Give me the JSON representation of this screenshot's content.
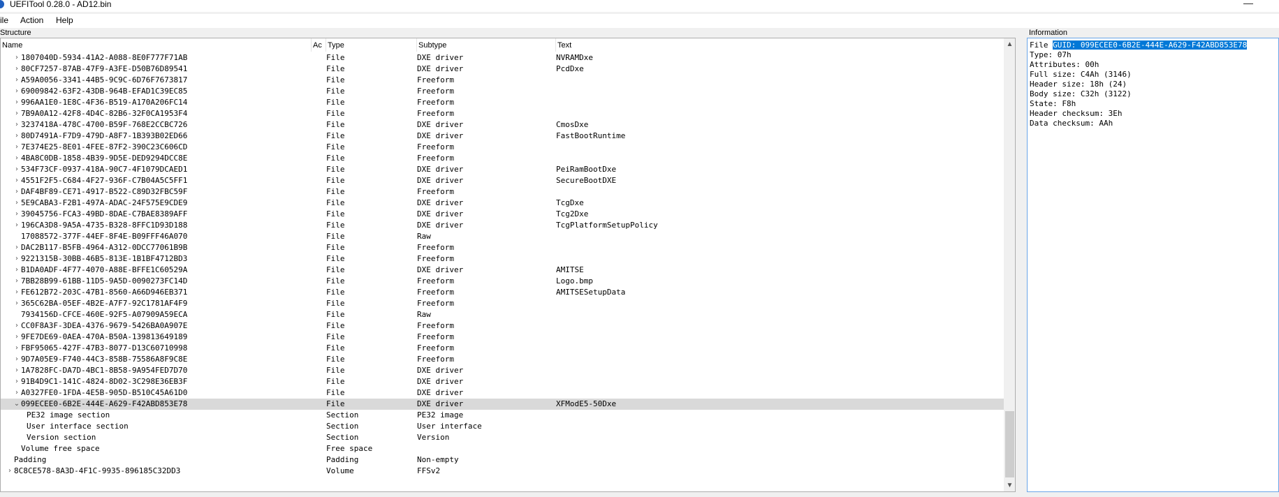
{
  "window": {
    "title": "UEFITool 0.28.0 - AD12.bin",
    "minimize_glyph": "—"
  },
  "menu": {
    "items": [
      "ile",
      "Action",
      "Help"
    ]
  },
  "panels": {
    "structure": "Structure",
    "information": "Information"
  },
  "columns": {
    "name": "Name",
    "action": "Ac",
    "type": "Type",
    "subtype": "Subtype",
    "text": "Text"
  },
  "tree_rows": [
    {
      "name": "1807040D-5934-41A2-A088-8E0F777F71AB",
      "type": "File",
      "subtype": "DXE driver",
      "text": "NVRAMDxe",
      "indent": 1,
      "expander": "collapsed"
    },
    {
      "name": "80CF7257-87AB-47F9-A3FE-D50B76D89541",
      "type": "File",
      "subtype": "DXE driver",
      "text": "PcdDxe",
      "indent": 1,
      "expander": "collapsed"
    },
    {
      "name": "A59A0056-3341-44B5-9C9C-6D76F7673817",
      "type": "File",
      "subtype": "Freeform",
      "text": "",
      "indent": 1,
      "expander": "collapsed"
    },
    {
      "name": "69009842-63F2-43DB-964B-EFAD1C39EC85",
      "type": "File",
      "subtype": "Freeform",
      "text": "",
      "indent": 1,
      "expander": "collapsed"
    },
    {
      "name": "996AA1E0-1E8C-4F36-B519-A170A206FC14",
      "type": "File",
      "subtype": "Freeform",
      "text": "",
      "indent": 1,
      "expander": "collapsed"
    },
    {
      "name": "7B9A0A12-42F8-4D4C-82B6-32F0CA1953F4",
      "type": "File",
      "subtype": "Freeform",
      "text": "",
      "indent": 1,
      "expander": "collapsed"
    },
    {
      "name": "3237418A-478C-4700-B59F-768E2CCBC726",
      "type": "File",
      "subtype": "DXE driver",
      "text": "CmosDxe",
      "indent": 1,
      "expander": "collapsed"
    },
    {
      "name": "80D7491A-F7D9-479D-A8F7-1B393B02ED66",
      "type": "File",
      "subtype": "DXE driver",
      "text": "FastBootRuntime",
      "indent": 1,
      "expander": "collapsed"
    },
    {
      "name": "7E374E25-8E01-4FEE-87F2-390C23C606CD",
      "type": "File",
      "subtype": "Freeform",
      "text": "",
      "indent": 1,
      "expander": "collapsed"
    },
    {
      "name": "4BA8C0DB-1858-4B39-9D5E-DED9294DCC8E",
      "type": "File",
      "subtype": "Freeform",
      "text": "",
      "indent": 1,
      "expander": "collapsed"
    },
    {
      "name": "534F73CF-0937-418A-90C7-4F1079DCAED1",
      "type": "File",
      "subtype": "DXE driver",
      "text": "PeiRamBootDxe",
      "indent": 1,
      "expander": "collapsed"
    },
    {
      "name": "4551F2F5-C684-4F27-936F-C7B04A5C5FF1",
      "type": "File",
      "subtype": "DXE driver",
      "text": "SecureBootDXE",
      "indent": 1,
      "expander": "collapsed"
    },
    {
      "name": "DAF4BF89-CE71-4917-B522-C89D32FBC59F",
      "type": "File",
      "subtype": "Freeform",
      "text": "",
      "indent": 1,
      "expander": "collapsed"
    },
    {
      "name": "5E9CABA3-F2B1-497A-ADAC-24F575E9CDE9",
      "type": "File",
      "subtype": "DXE driver",
      "text": "TcgDxe",
      "indent": 1,
      "expander": "collapsed"
    },
    {
      "name": "39045756-FCA3-49BD-8DAE-C7BAE8389AFF",
      "type": "File",
      "subtype": "DXE driver",
      "text": "Tcg2Dxe",
      "indent": 1,
      "expander": "collapsed"
    },
    {
      "name": "196CA3D8-9A5A-4735-B328-8FFC1D93D188",
      "type": "File",
      "subtype": "DXE driver",
      "text": "TcgPlatformSetupPolicy",
      "indent": 1,
      "expander": "collapsed"
    },
    {
      "name": "17088572-377F-44EF-8F4E-B09FFF46A070",
      "type": "File",
      "subtype": "Raw",
      "text": "",
      "indent": 1,
      "expander": "none"
    },
    {
      "name": "DAC2B117-B5FB-4964-A312-0DCC77061B9B",
      "type": "File",
      "subtype": "Freeform",
      "text": "",
      "indent": 1,
      "expander": "collapsed"
    },
    {
      "name": "9221315B-30BB-46B5-813E-1B1BF4712BD3",
      "type": "File",
      "subtype": "Freeform",
      "text": "",
      "indent": 1,
      "expander": "collapsed"
    },
    {
      "name": "B1DA0ADF-4F77-4070-A88E-BFFE1C60529A",
      "type": "File",
      "subtype": "DXE driver",
      "text": "AMITSE",
      "indent": 1,
      "expander": "collapsed"
    },
    {
      "name": "7BB28B99-61BB-11D5-9A5D-0090273FC14D",
      "type": "File",
      "subtype": "Freeform",
      "text": "Logo.bmp",
      "indent": 1,
      "expander": "collapsed"
    },
    {
      "name": "FE612B72-203C-47B1-8560-A66D946EB371",
      "type": "File",
      "subtype": "Freeform",
      "text": "AMITSESetupData",
      "indent": 1,
      "expander": "collapsed"
    },
    {
      "name": "365C62BA-05EF-4B2E-A7F7-92C1781AF4F9",
      "type": "File",
      "subtype": "Freeform",
      "text": "",
      "indent": 1,
      "expander": "collapsed"
    },
    {
      "name": "7934156D-CFCE-460E-92F5-A07909A59ECA",
      "type": "File",
      "subtype": "Raw",
      "text": "",
      "indent": 1,
      "expander": "none"
    },
    {
      "name": "CC0F8A3F-3DEA-4376-9679-5426BA0A907E",
      "type": "File",
      "subtype": "Freeform",
      "text": "",
      "indent": 1,
      "expander": "collapsed"
    },
    {
      "name": "9FE7DE69-0AEA-470A-B50A-139813649189",
      "type": "File",
      "subtype": "Freeform",
      "text": "",
      "indent": 1,
      "expander": "collapsed"
    },
    {
      "name": "FBF95065-427F-47B3-8077-D13C60710998",
      "type": "File",
      "subtype": "Freeform",
      "text": "",
      "indent": 1,
      "expander": "collapsed"
    },
    {
      "name": "9D7A05E9-F740-44C3-858B-75586A8F9C8E",
      "type": "File",
      "subtype": "Freeform",
      "text": "",
      "indent": 1,
      "expander": "collapsed"
    },
    {
      "name": "1A7828FC-DA7D-4BC1-8B58-9A954FED7D70",
      "type": "File",
      "subtype": "DXE driver",
      "text": "",
      "indent": 1,
      "expander": "collapsed"
    },
    {
      "name": "91B4D9C1-141C-4824-8D02-3C298E36EB3F",
      "type": "File",
      "subtype": "DXE driver",
      "text": "",
      "indent": 1,
      "expander": "collapsed"
    },
    {
      "name": "A0327FE0-1FDA-4E5B-905D-B510C45A61D0",
      "type": "File",
      "subtype": "DXE driver",
      "text": "",
      "indent": 1,
      "expander": "collapsed"
    },
    {
      "name": "099ECEE0-6B2E-444E-A629-F42ABD853E78",
      "type": "File",
      "subtype": "DXE driver",
      "text": "XFModE5-50Dxe",
      "indent": 1,
      "expander": "expanded",
      "selected": true
    },
    {
      "name": "PE32 image section",
      "type": "Section",
      "subtype": "PE32 image",
      "text": "",
      "indent": 2,
      "expander": "none"
    },
    {
      "name": "User interface section",
      "type": "Section",
      "subtype": "User interface",
      "text": "",
      "indent": 2,
      "expander": "none"
    },
    {
      "name": "Version section",
      "type": "Section",
      "subtype": "Version",
      "text": "",
      "indent": 2,
      "expander": "none"
    },
    {
      "name": "Volume free space",
      "type": "Free space",
      "subtype": "",
      "text": "",
      "indent": 1,
      "expander": "none"
    },
    {
      "name": "Padding",
      "type": "Padding",
      "subtype": "Non-empty",
      "text": "",
      "indent": 0,
      "expander": "none"
    },
    {
      "name": "8C8CE578-8A3D-4F1C-9935-896185C32DD3",
      "type": "Volume",
      "subtype": "FFSv2",
      "text": "",
      "indent": 0,
      "expander": "collapsed"
    }
  ],
  "info": {
    "file_prefix": "File ",
    "guid": "GUID: 099ECEE0-6B2E-444E-A629-F42ABD853E78",
    "lines": [
      "Type: 07h",
      "Attributes: 00h",
      "Full size: C4Ah (3146)",
      "Header size: 18h (24)",
      "Body size: C32h (3122)",
      "State: F8h",
      "Header checksum: 3Eh",
      "Data checksum: AAh"
    ]
  },
  "glyphs": {
    "collapsed": "›",
    "expanded": "⌄",
    "scroll_up": "▲",
    "scroll_down": "▼"
  }
}
